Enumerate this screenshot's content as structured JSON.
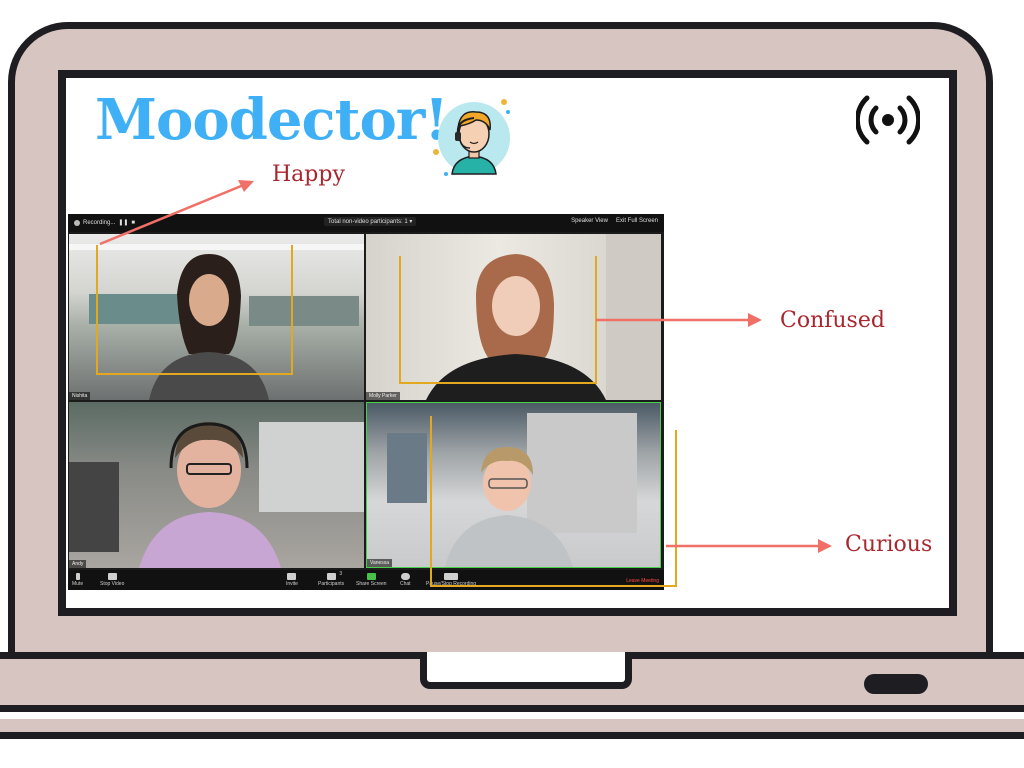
{
  "app": {
    "title": "Moodector!",
    "live_icon": "broadcast-icon",
    "avatar_icon": "headset-agent-avatar"
  },
  "annotations": [
    {
      "label": "Happy",
      "color": "#a8272e"
    },
    {
      "label": "Confused",
      "color": "#a8272e"
    },
    {
      "label": "Curious",
      "color": "#a8272e"
    }
  ],
  "meeting": {
    "recording_label": "Recording...",
    "participants_dropdown": "Total non-video participants: 1",
    "speaker_view": "Speaker View",
    "exit_full_screen": "Exit Full Screen",
    "tiles": [
      {
        "name": "Nishita"
      },
      {
        "name": "Molly Parker"
      },
      {
        "name": "Andy"
      },
      {
        "name": "Vanessa"
      }
    ],
    "controls": {
      "mute": "Mute",
      "stop_video": "Stop Video",
      "invite": "Invite",
      "participants": "Participants",
      "participants_count": "3",
      "share_screen": "Share Screen",
      "chat": "Chat",
      "pause_recording": "Pause/Stop Recording",
      "leave": "Leave Meeting"
    }
  },
  "colors": {
    "title": "#3fb0f5",
    "laptop_body": "#d7c5c1",
    "outline": "#1e1e22",
    "arrow": "#f07068",
    "face_box": "#e2a820",
    "leave_meeting": "#ff4a3d"
  }
}
